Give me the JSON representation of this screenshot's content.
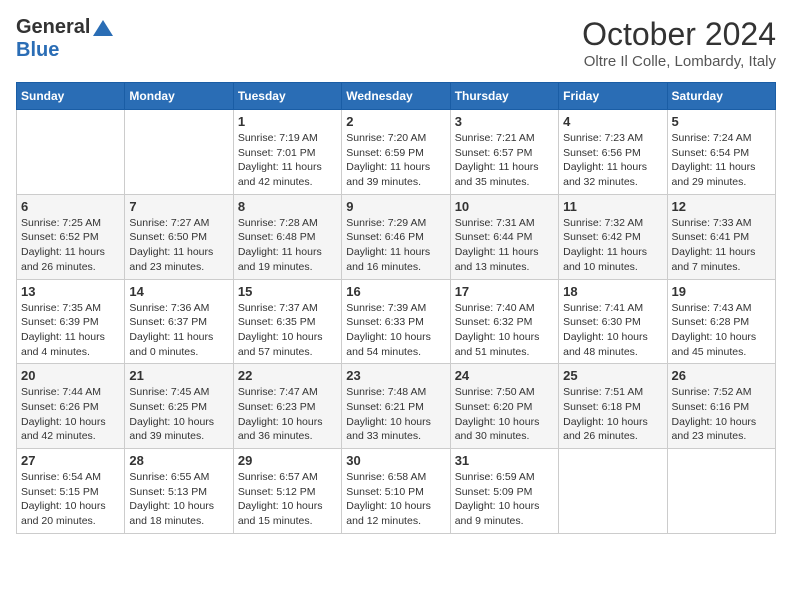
{
  "header": {
    "logo_general": "General",
    "logo_blue": "Blue",
    "month_title": "October 2024",
    "location": "Oltre Il Colle, Lombardy, Italy"
  },
  "days_of_week": [
    "Sunday",
    "Monday",
    "Tuesday",
    "Wednesday",
    "Thursday",
    "Friday",
    "Saturday"
  ],
  "weeks": [
    [
      {
        "day": "",
        "info": ""
      },
      {
        "day": "",
        "info": ""
      },
      {
        "day": "1",
        "info": "Sunrise: 7:19 AM\nSunset: 7:01 PM\nDaylight: 11 hours and 42 minutes."
      },
      {
        "day": "2",
        "info": "Sunrise: 7:20 AM\nSunset: 6:59 PM\nDaylight: 11 hours and 39 minutes."
      },
      {
        "day": "3",
        "info": "Sunrise: 7:21 AM\nSunset: 6:57 PM\nDaylight: 11 hours and 35 minutes."
      },
      {
        "day": "4",
        "info": "Sunrise: 7:23 AM\nSunset: 6:56 PM\nDaylight: 11 hours and 32 minutes."
      },
      {
        "day": "5",
        "info": "Sunrise: 7:24 AM\nSunset: 6:54 PM\nDaylight: 11 hours and 29 minutes."
      }
    ],
    [
      {
        "day": "6",
        "info": "Sunrise: 7:25 AM\nSunset: 6:52 PM\nDaylight: 11 hours and 26 minutes."
      },
      {
        "day": "7",
        "info": "Sunrise: 7:27 AM\nSunset: 6:50 PM\nDaylight: 11 hours and 23 minutes."
      },
      {
        "day": "8",
        "info": "Sunrise: 7:28 AM\nSunset: 6:48 PM\nDaylight: 11 hours and 19 minutes."
      },
      {
        "day": "9",
        "info": "Sunrise: 7:29 AM\nSunset: 6:46 PM\nDaylight: 11 hours and 16 minutes."
      },
      {
        "day": "10",
        "info": "Sunrise: 7:31 AM\nSunset: 6:44 PM\nDaylight: 11 hours and 13 minutes."
      },
      {
        "day": "11",
        "info": "Sunrise: 7:32 AM\nSunset: 6:42 PM\nDaylight: 11 hours and 10 minutes."
      },
      {
        "day": "12",
        "info": "Sunrise: 7:33 AM\nSunset: 6:41 PM\nDaylight: 11 hours and 7 minutes."
      }
    ],
    [
      {
        "day": "13",
        "info": "Sunrise: 7:35 AM\nSunset: 6:39 PM\nDaylight: 11 hours and 4 minutes."
      },
      {
        "day": "14",
        "info": "Sunrise: 7:36 AM\nSunset: 6:37 PM\nDaylight: 11 hours and 0 minutes."
      },
      {
        "day": "15",
        "info": "Sunrise: 7:37 AM\nSunset: 6:35 PM\nDaylight: 10 hours and 57 minutes."
      },
      {
        "day": "16",
        "info": "Sunrise: 7:39 AM\nSunset: 6:33 PM\nDaylight: 10 hours and 54 minutes."
      },
      {
        "day": "17",
        "info": "Sunrise: 7:40 AM\nSunset: 6:32 PM\nDaylight: 10 hours and 51 minutes."
      },
      {
        "day": "18",
        "info": "Sunrise: 7:41 AM\nSunset: 6:30 PM\nDaylight: 10 hours and 48 minutes."
      },
      {
        "day": "19",
        "info": "Sunrise: 7:43 AM\nSunset: 6:28 PM\nDaylight: 10 hours and 45 minutes."
      }
    ],
    [
      {
        "day": "20",
        "info": "Sunrise: 7:44 AM\nSunset: 6:26 PM\nDaylight: 10 hours and 42 minutes."
      },
      {
        "day": "21",
        "info": "Sunrise: 7:45 AM\nSunset: 6:25 PM\nDaylight: 10 hours and 39 minutes."
      },
      {
        "day": "22",
        "info": "Sunrise: 7:47 AM\nSunset: 6:23 PM\nDaylight: 10 hours and 36 minutes."
      },
      {
        "day": "23",
        "info": "Sunrise: 7:48 AM\nSunset: 6:21 PM\nDaylight: 10 hours and 33 minutes."
      },
      {
        "day": "24",
        "info": "Sunrise: 7:50 AM\nSunset: 6:20 PM\nDaylight: 10 hours and 30 minutes."
      },
      {
        "day": "25",
        "info": "Sunrise: 7:51 AM\nSunset: 6:18 PM\nDaylight: 10 hours and 26 minutes."
      },
      {
        "day": "26",
        "info": "Sunrise: 7:52 AM\nSunset: 6:16 PM\nDaylight: 10 hours and 23 minutes."
      }
    ],
    [
      {
        "day": "27",
        "info": "Sunrise: 6:54 AM\nSunset: 5:15 PM\nDaylight: 10 hours and 20 minutes."
      },
      {
        "day": "28",
        "info": "Sunrise: 6:55 AM\nSunset: 5:13 PM\nDaylight: 10 hours and 18 minutes."
      },
      {
        "day": "29",
        "info": "Sunrise: 6:57 AM\nSunset: 5:12 PM\nDaylight: 10 hours and 15 minutes."
      },
      {
        "day": "30",
        "info": "Sunrise: 6:58 AM\nSunset: 5:10 PM\nDaylight: 10 hours and 12 minutes."
      },
      {
        "day": "31",
        "info": "Sunrise: 6:59 AM\nSunset: 5:09 PM\nDaylight: 10 hours and 9 minutes."
      },
      {
        "day": "",
        "info": ""
      },
      {
        "day": "",
        "info": ""
      }
    ]
  ]
}
